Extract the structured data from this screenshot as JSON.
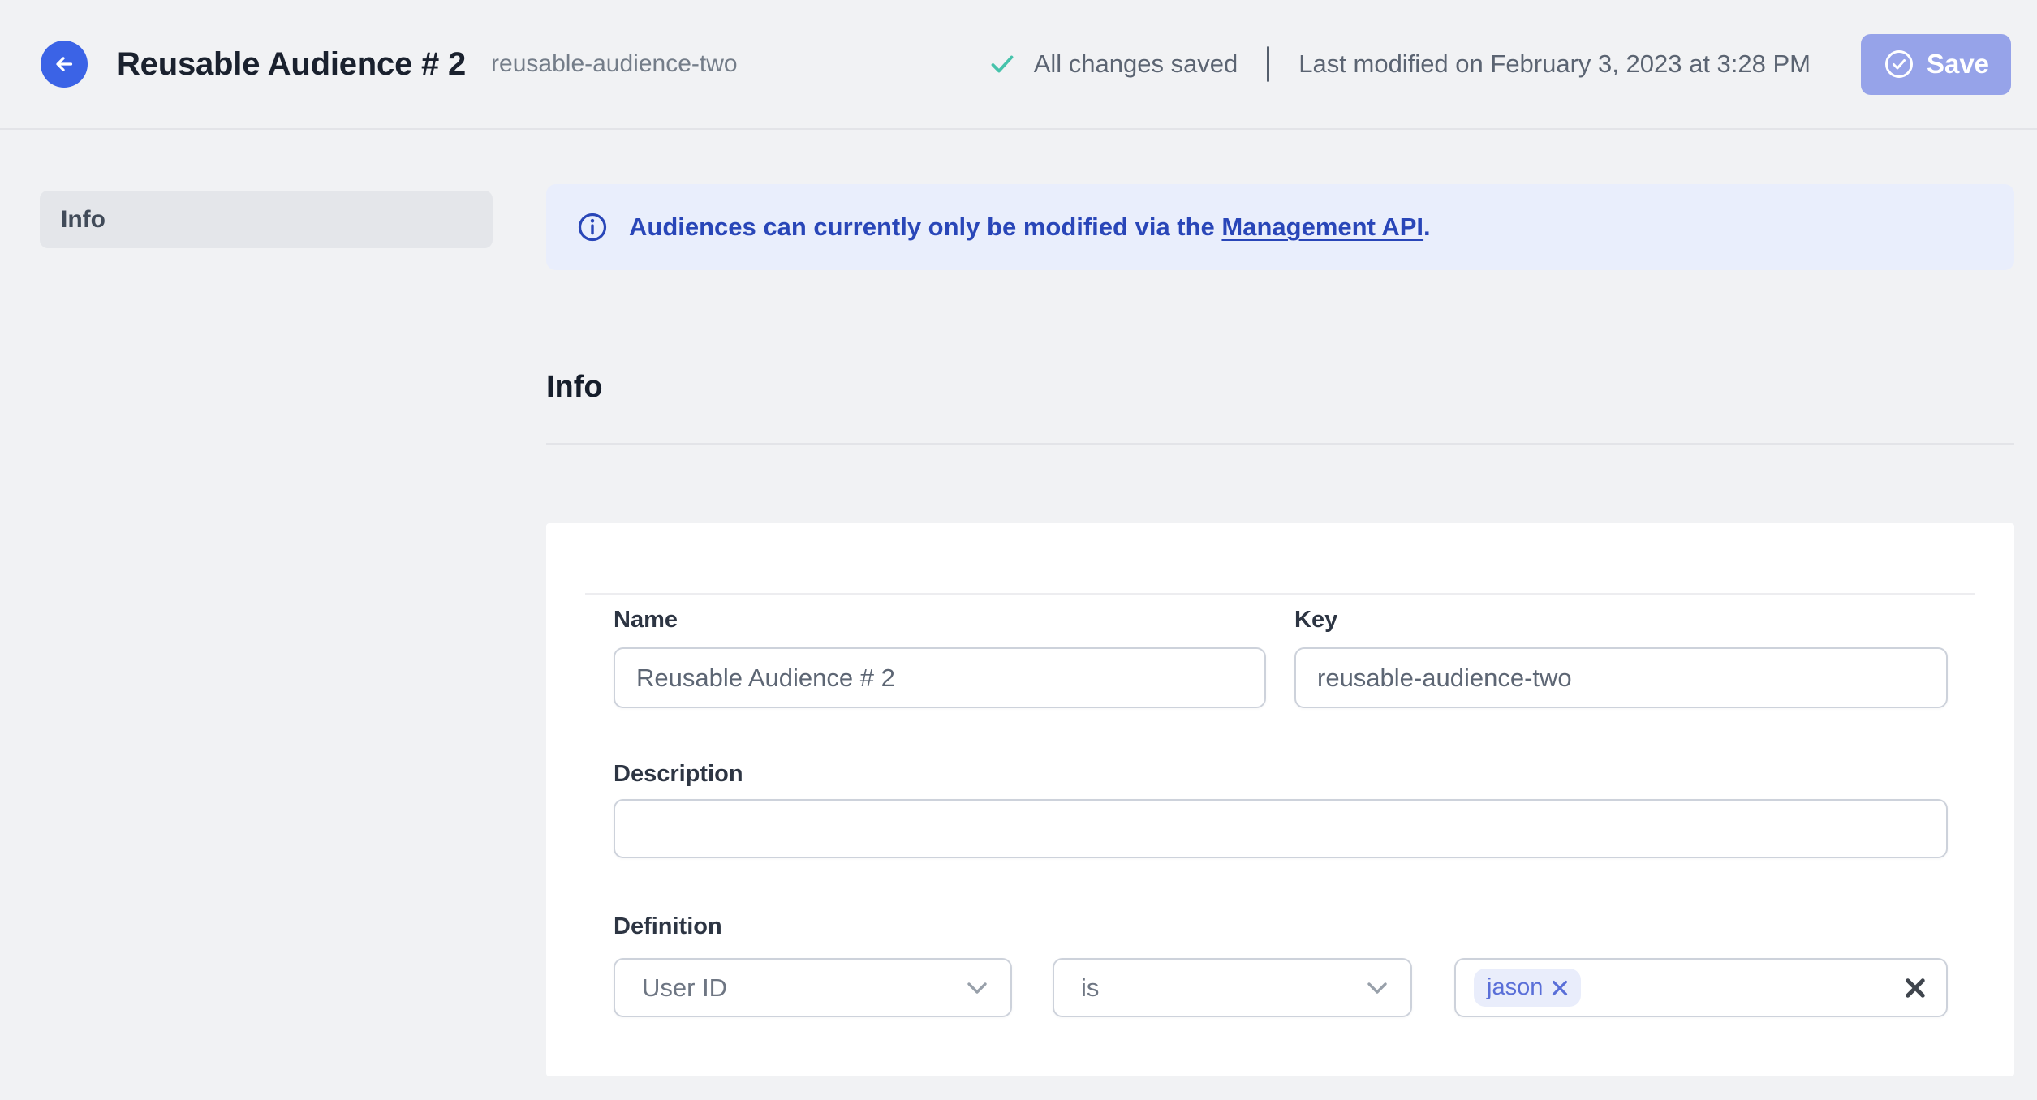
{
  "header": {
    "title": "Reusable Audience # 2",
    "slug": "reusable-audience-two",
    "saved_status": "All changes saved",
    "last_modified": "Last modified on February 3, 2023 at 3:28 PM",
    "save_label": "Save"
  },
  "sidebar": {
    "items": [
      {
        "label": "Info",
        "active": true
      }
    ]
  },
  "banner": {
    "text_before_link": "Audiences can currently only be modified via the ",
    "link_text": "Management API",
    "text_after_link": "."
  },
  "section": {
    "heading": "Info"
  },
  "form": {
    "name": {
      "label": "Name",
      "value": "Reusable Audience # 2"
    },
    "key": {
      "label": "Key",
      "value": "reusable-audience-two"
    },
    "description": {
      "label": "Description",
      "value": ""
    },
    "definition": {
      "label": "Definition",
      "trait_selector": "User ID",
      "operator_selector": "is",
      "values": [
        "jason"
      ]
    }
  },
  "icons": {
    "back": "arrow-left",
    "saved": "checkmark",
    "save_button": "check-circle",
    "banner": "info-circle",
    "selects": "chevron-down",
    "chip_remove": "x-small",
    "clear_value": "x-bold"
  },
  "colors": {
    "page_bg": "#f1f2f4",
    "accent_blue": "#3b63e6",
    "save_button_bg": "#96a3e9",
    "banner_bg": "#e9eefc",
    "banner_text": "#2946b8",
    "success_teal": "#46c3ab",
    "chip_bg": "#e9edfb",
    "chip_text": "#5a6fd8",
    "title_text": "#1a212e",
    "muted_text": "#5b6472"
  }
}
